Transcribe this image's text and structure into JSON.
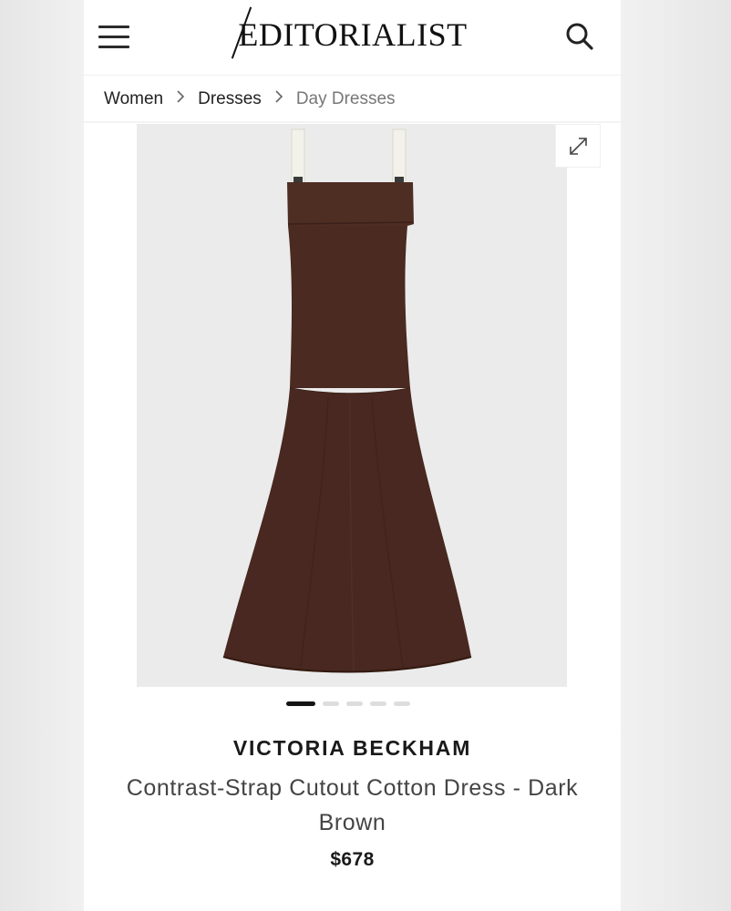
{
  "header": {
    "menu_icon": "hamburger-menu-icon",
    "logo_text": "EDITORIALIST",
    "search_icon": "search-icon"
  },
  "breadcrumb": {
    "items": [
      "Women",
      "Dresses",
      "Day Dresses"
    ],
    "separator_icon": "chevron-right-icon"
  },
  "gallery": {
    "expand_icon": "expand-arrows-icon",
    "image_count": 5,
    "active_index": 0,
    "background_color": "#ebebeb",
    "dress_color": "#4a2a21",
    "strap_color": "#f2f2ea"
  },
  "product": {
    "brand": "VICTORIA BECKHAM",
    "name": "Contrast-Strap Cutout Cotton Dress - Dark Brown",
    "price": "$678"
  }
}
